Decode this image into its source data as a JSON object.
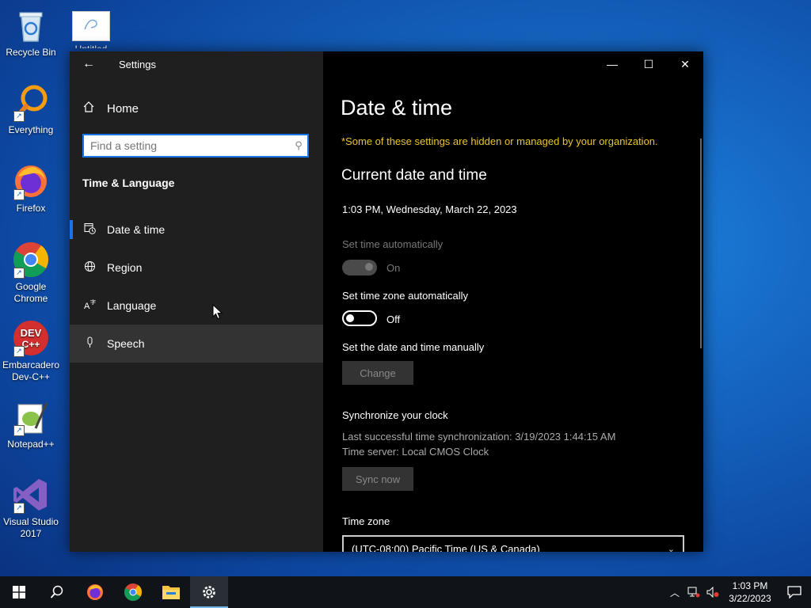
{
  "desktop": {
    "icons": [
      {
        "label": "Recycle Bin"
      },
      {
        "label": "Everything"
      },
      {
        "label": "Firefox"
      },
      {
        "label": "Google Chrome"
      },
      {
        "label": "Embarcadero Dev-C++"
      },
      {
        "label": "Notepad++"
      },
      {
        "label": "Visual Studio 2017"
      }
    ],
    "top_partial_label": "Untitled"
  },
  "window": {
    "title": "Settings",
    "back_icon": "←",
    "controls": {
      "minimize": "—",
      "maximize": "☐",
      "close": "✕"
    }
  },
  "sidebar": {
    "home_label": "Home",
    "search_placeholder": "Find a setting",
    "section_title": "Time & Language",
    "items": [
      {
        "label": "Date & time",
        "selected": true
      },
      {
        "label": "Region"
      },
      {
        "label": "Language"
      },
      {
        "label": "Speech",
        "hover": true
      }
    ]
  },
  "content": {
    "title": "Date & time",
    "notice": "*Some of these settings are hidden or managed by your organization.",
    "section_heading": "Current date and time",
    "current": "1:03 PM, Wednesday, March 22, 2023",
    "set_time_auto": {
      "label": "Set time automatically",
      "state": "On"
    },
    "set_tz_auto": {
      "label": "Set time zone automatically",
      "state": "Off"
    },
    "manual": {
      "label": "Set the date and time manually",
      "button": "Change"
    },
    "sync": {
      "heading": "Synchronize your clock",
      "last": "Last successful time synchronization: 3/19/2023 1:44:15 AM",
      "server": "Time server: Local CMOS Clock",
      "button": "Sync now"
    },
    "timezone": {
      "label": "Time zone",
      "value": "(UTC-08:00) Pacific Time (US & Canada)"
    }
  },
  "taskbar": {
    "time": "1:03 PM",
    "date": "3/22/2023"
  },
  "colors": {
    "accent": "#1a73e8",
    "notice": "#e9c52b"
  }
}
